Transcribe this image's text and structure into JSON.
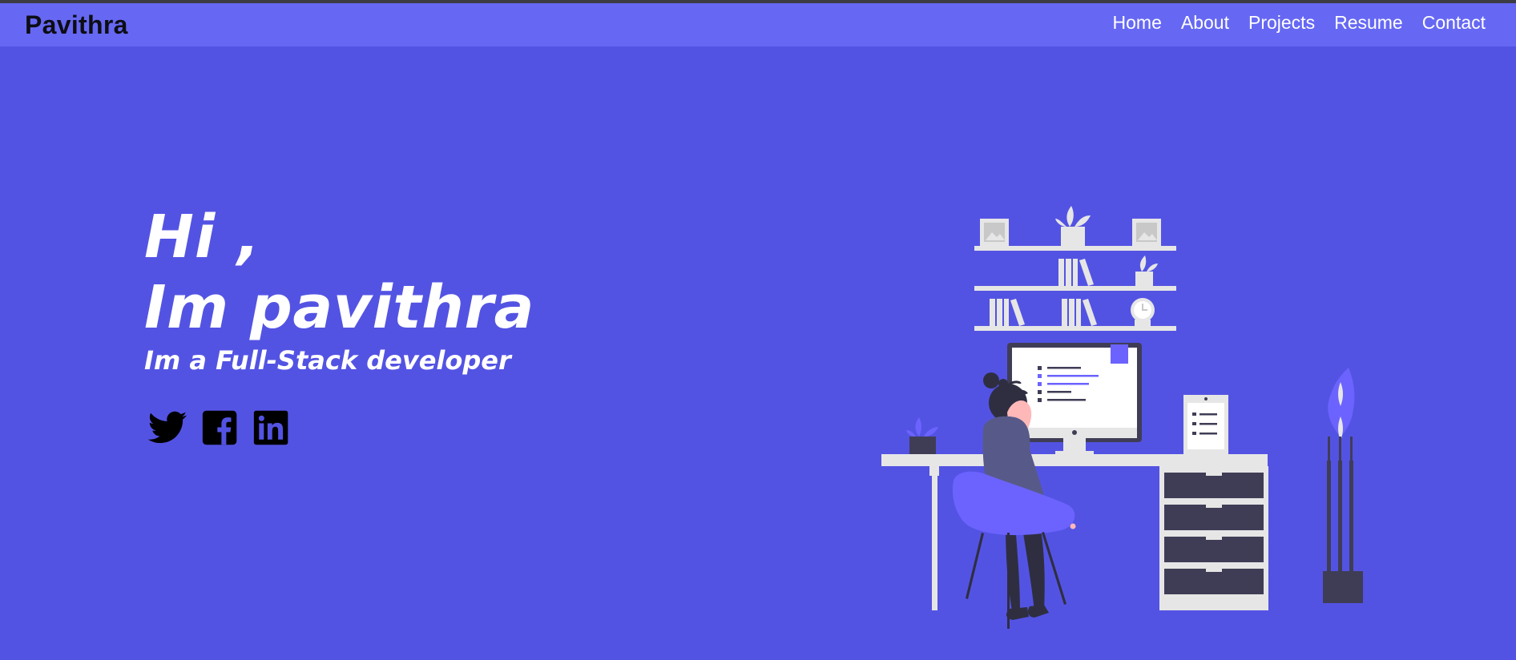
{
  "header": {
    "brand": "Pavithra",
    "nav": [
      "Home",
      "About",
      "Projects",
      "Resume",
      "Contact"
    ]
  },
  "hero": {
    "greeting": "Hi ,",
    "name_line": "Im pavithra",
    "role_line": "Im a Full-Stack developer"
  },
  "socials": [
    {
      "icon": "twitter-icon"
    },
    {
      "icon": "facebook-icon"
    },
    {
      "icon": "linkedin-icon"
    }
  ],
  "colors": {
    "background": "#5353e3",
    "navbar": "#6668f3",
    "brand_text": "#0d0d14",
    "hero_text": "#ffffff",
    "accent": "#6c63ff"
  }
}
